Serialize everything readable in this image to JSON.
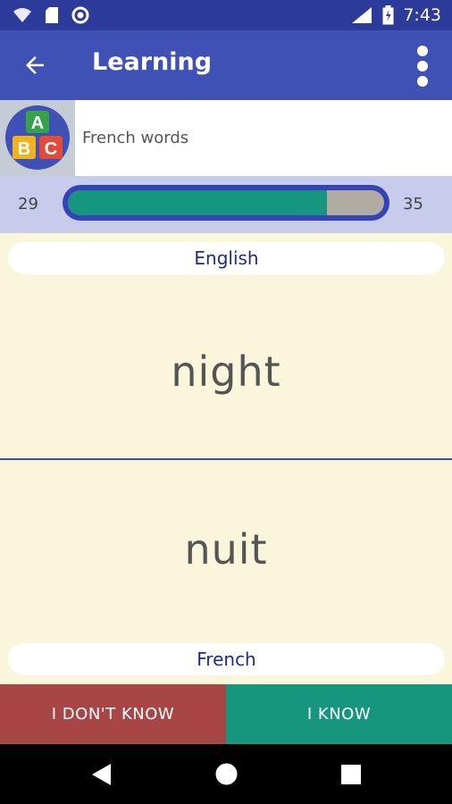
{
  "status_bar": {
    "time": "7:43"
  },
  "app_bar": {
    "title": "Learning"
  },
  "deck": {
    "name": "French words",
    "logo_letters": [
      "A",
      "B",
      "C"
    ]
  },
  "progress": {
    "left_count": "29",
    "right_count": "35",
    "fill_fraction": 0.82
  },
  "card": {
    "top_language": "English",
    "top_word": "night",
    "bottom_word": "nuit",
    "bottom_language": "French"
  },
  "buttons": {
    "dont_know": "I DON'T KNOW",
    "know": "I KNOW"
  },
  "colors": {
    "primary": "#3f51b5",
    "status": "#2c3a9a",
    "red": "#a84646",
    "green": "#17967f",
    "card": "#faf6dc"
  },
  "icons": [
    "wifi-icon",
    "sd-card-icon",
    "sync-icon",
    "lte-signal-icon",
    "battery-icon",
    "back-arrow-icon",
    "more-vert-icon",
    "abc-logo-icon",
    "nav-back-icon",
    "nav-home-icon",
    "nav-recents-icon"
  ]
}
